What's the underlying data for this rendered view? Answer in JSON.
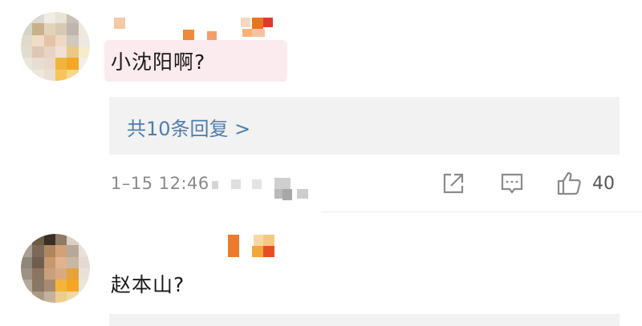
{
  "comments": [
    {
      "text": "小沈阳啊?",
      "replies_link": "共10条回复 >",
      "time": "1–15 12:46",
      "like_count": "40"
    },
    {
      "text": "赵本山?"
    }
  ],
  "icons": {
    "share": "share-icon",
    "comment": "comment-icon",
    "like": "thumbs-up-icon"
  },
  "colors": {
    "link": "#4f7cac",
    "highlight": "#fcebee",
    "reply_bg": "#f2f2f2"
  }
}
